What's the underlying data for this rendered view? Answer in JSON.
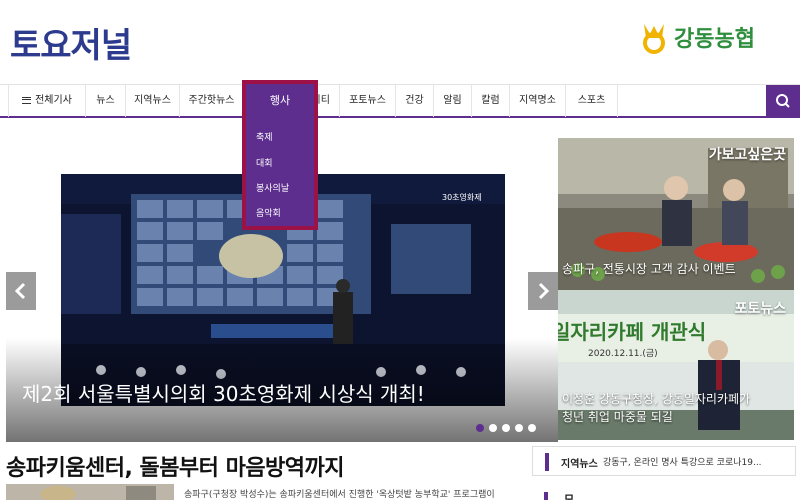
{
  "header": {
    "logo_text": "토요저널",
    "partner_name": "강동농협"
  },
  "nav": {
    "all_articles": "전체기사",
    "items": [
      "뉴스",
      "지역뉴스",
      "주간핫뉴스",
      "행사",
      "커뮤니티",
      "포토뉴스",
      "건강",
      "알림",
      "칼럼",
      "지역명소",
      "스포츠"
    ],
    "active_index": 3,
    "search_icon": "search-icon"
  },
  "dropdown": {
    "title": "행사",
    "items": [
      "축제",
      "대회",
      "봉사의날",
      "음악회"
    ]
  },
  "slider": {
    "caption": "제2회 서울특별시의회 30초영화제 시상식 개최!",
    "screen_badge": "30초영화제",
    "dots": 5,
    "active_dot": 0
  },
  "cards": [
    {
      "tag": "가보고싶은곳",
      "caption": "송파구, 전통시장 고객 감사 이벤트"
    },
    {
      "tag": "포토뉴스",
      "sign_text": "일자리카페 개관식",
      "sign_date": "2020.12.11.(금)",
      "caption_lines": [
        "이정훈 강동구청장, 강동일자리카페가",
        "청년 취업 마중물 되길"
      ]
    }
  ],
  "headline": "송파키움센터, 돌봄부터 마음방역까지",
  "summary": "송파구(구청장 박성수)는 송파키움센터에서 진행한 '옥상텃밭 농부학교' 프로그램이",
  "ticker": {
    "label": "지역뉴스",
    "text": "강동구, 온라인 명사 특강으로 코로나19..."
  },
  "section2": {
    "label": "모집"
  },
  "colors": {
    "brand_navy": "#2d3b8e",
    "nav_purple": "#5d2e8e",
    "dropdown_border": "#9c1246",
    "partner_green": "#2f8f3e"
  }
}
